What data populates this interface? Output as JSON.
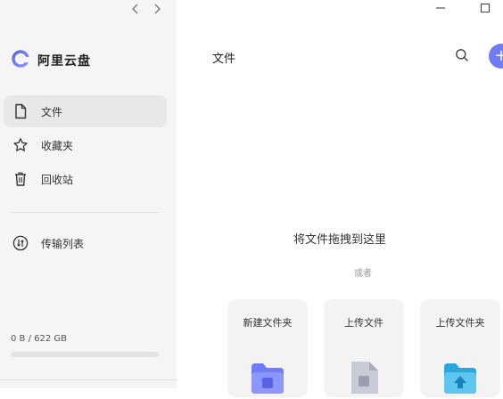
{
  "app": {
    "name": "阿里云盘"
  },
  "sidebar": {
    "items": [
      {
        "label": "文件",
        "icon": "file-icon",
        "active": true
      },
      {
        "label": "收藏夹",
        "icon": "star-icon",
        "active": false
      },
      {
        "label": "回收站",
        "icon": "trash-icon",
        "active": false
      },
      {
        "label": "传输列表",
        "icon": "transfer-icon",
        "active": false
      }
    ],
    "storage": {
      "text": "0 B / 622 GB",
      "used_fraction": 0
    }
  },
  "main": {
    "title": "文件",
    "drop_text": "将文件拖拽到这里",
    "or_text": "或者",
    "cards": [
      {
        "label": "新建文件夹",
        "icon": "new-folder-icon"
      },
      {
        "label": "上传文件",
        "icon": "upload-file-icon"
      },
      {
        "label": "上传文件夹",
        "icon": "upload-folder-icon"
      }
    ]
  },
  "colors": {
    "accent": "#6f7bf7",
    "sidebar_bg": "#f5f5f5",
    "active_bg": "#e8e8e8",
    "card_bg": "#f3f3f3"
  }
}
